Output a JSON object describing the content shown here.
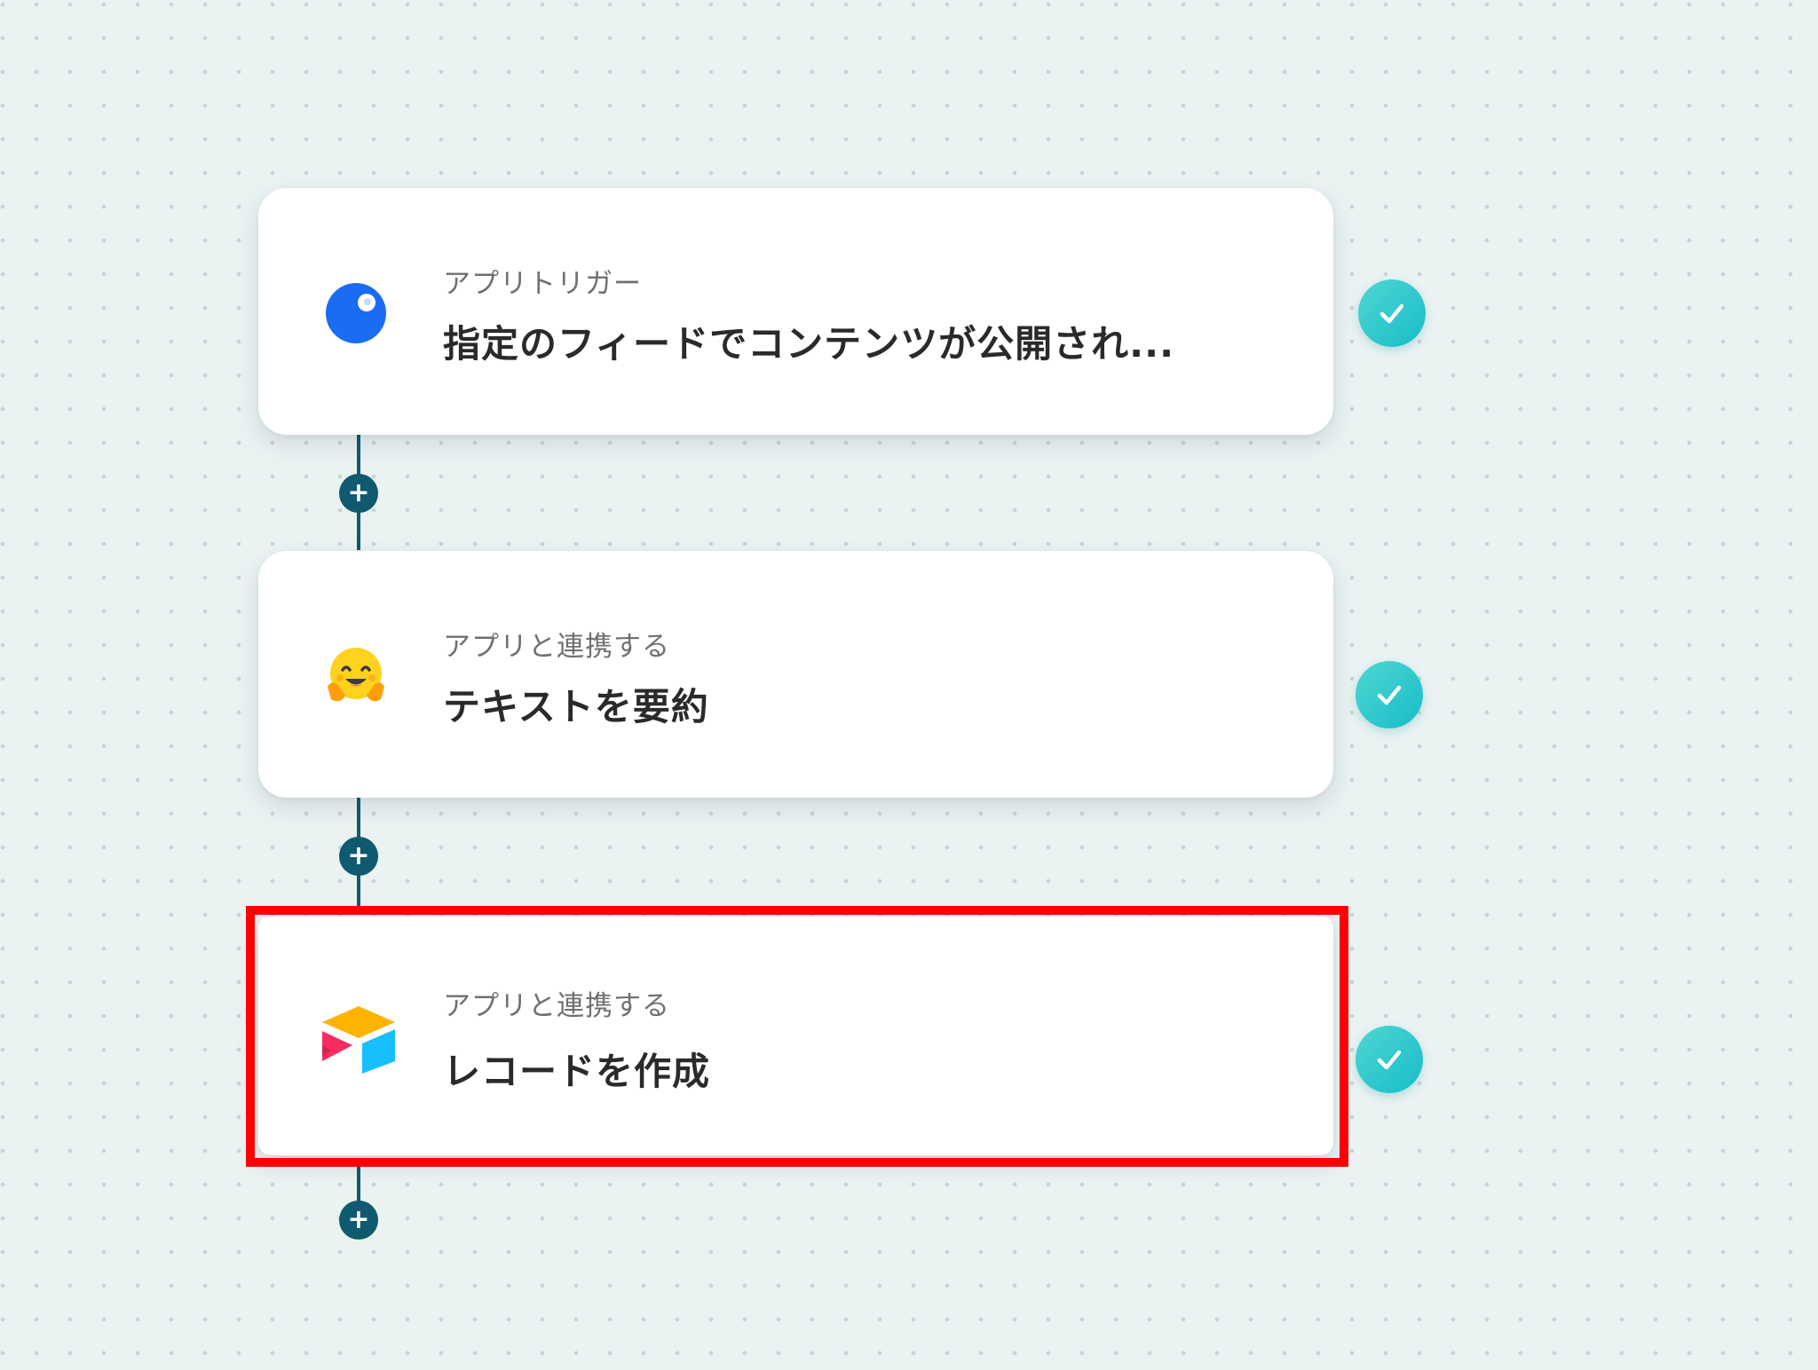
{
  "flow": {
    "steps": [
      {
        "subtitle": "アプリトリガー",
        "title": "指定のフィードでコンテンツが公開され...",
        "icon": "rss-feed-icon",
        "status": "completed"
      },
      {
        "subtitle": "アプリと連携する",
        "title": "テキストを要約",
        "icon": "hugging-face-icon",
        "status": "completed"
      },
      {
        "subtitle": "アプリと連携する",
        "title": "レコードを作成",
        "icon": "airtable-icon",
        "status": "completed",
        "highlighted": true
      }
    ],
    "add_step_icon": "plus-icon",
    "status_icon": "check-icon"
  },
  "colors": {
    "canvas_background": "#eaf2f2",
    "connector": "#0f5a6e",
    "check_badge": "#1fc6cc",
    "highlight": "#ff0000",
    "feed_icon": "#1a6cf2"
  }
}
